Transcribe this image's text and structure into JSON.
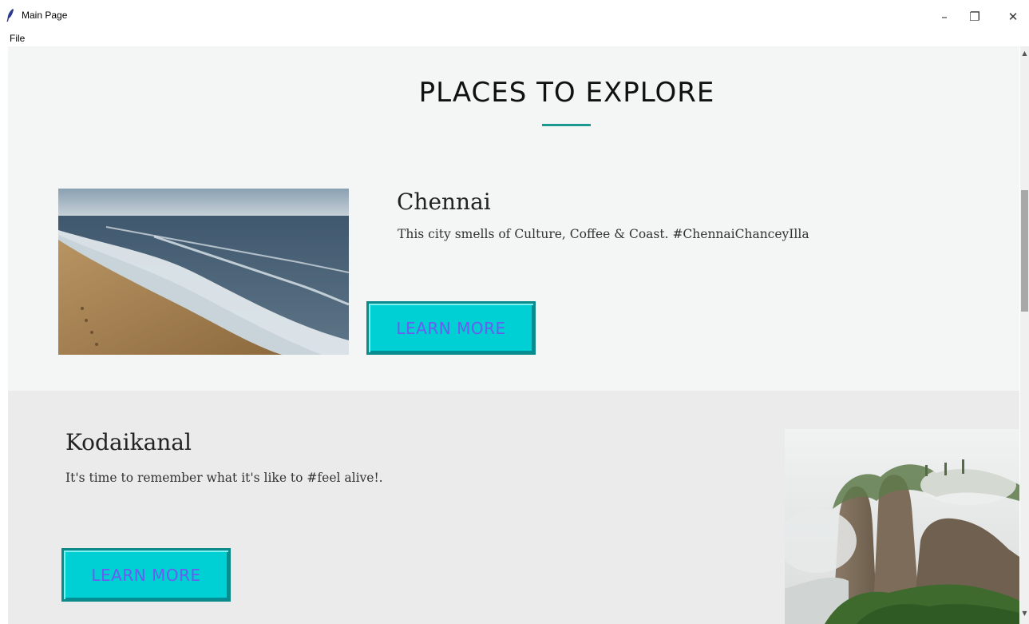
{
  "window": {
    "title": "Main Page",
    "minimize_glyph": "–",
    "restore_glyph": "❐",
    "close_glyph": "✕"
  },
  "menu": {
    "file": "File"
  },
  "page": {
    "heading": "PLACES TO EXPLORE",
    "accent_color": "#1c9a8f"
  },
  "places": [
    {
      "name": "Chennai",
      "description": "This city smells of Culture, Coffee & Coast. #ChennaiChanceyIlla",
      "button_label": "LEARN MORE",
      "image_icon": "beach-photo"
    },
    {
      "name": "Kodaikanal",
      "description": "It's time to remember what it's like to #feel alive!.",
      "button_label": "LEARN MORE",
      "image_icon": "mountain-photo"
    }
  ],
  "colors": {
    "button_bg": "#00cfd3",
    "button_text": "#6a5cf0",
    "section_light": "#f4f5f5",
    "section_dark": "#ebebeb"
  }
}
